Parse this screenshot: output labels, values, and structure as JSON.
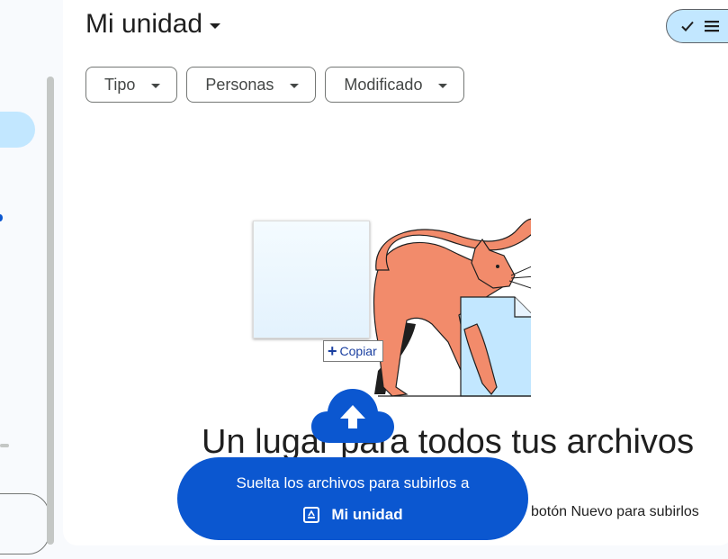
{
  "header": {
    "title": "Mi unidad"
  },
  "filters": [
    {
      "label": "Tipo"
    },
    {
      "label": "Personas"
    },
    {
      "label": "Modificado"
    }
  ],
  "empty_state": {
    "headline": "Un lugar para todos tus archivos",
    "subtext": "botón Nuevo para subirlos"
  },
  "drag": {
    "tooltip": "Copiar"
  },
  "drop_banner": {
    "line1": "Suelta los archivos para subirlos a",
    "destination": "Mi unidad"
  },
  "colors": {
    "accent": "#0b57d0",
    "selected": "#c2e7ff",
    "cat": "#f28b6b",
    "file": "#c2e7ff"
  }
}
